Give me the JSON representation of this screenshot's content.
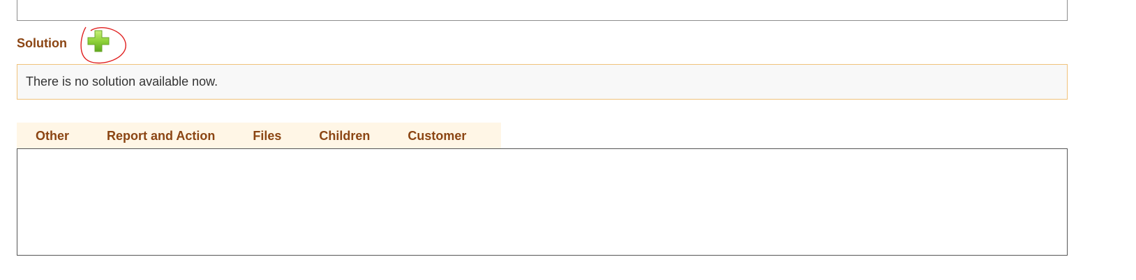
{
  "solution": {
    "heading": "Solution",
    "add_icon": "plus-icon",
    "empty_message": "There is no solution available now."
  },
  "tabs": [
    {
      "label": "Other"
    },
    {
      "label": "Report and Action"
    },
    {
      "label": "Files"
    },
    {
      "label": "Children"
    },
    {
      "label": "Customer"
    }
  ],
  "colors": {
    "heading": "#8b4513",
    "tab_bar_bg": "#fff6e6",
    "solution_border": "#f0c27b",
    "solution_bg": "#f8f8f8",
    "annotation_circle": "#e02020",
    "plus_green": "#8fd13a"
  }
}
